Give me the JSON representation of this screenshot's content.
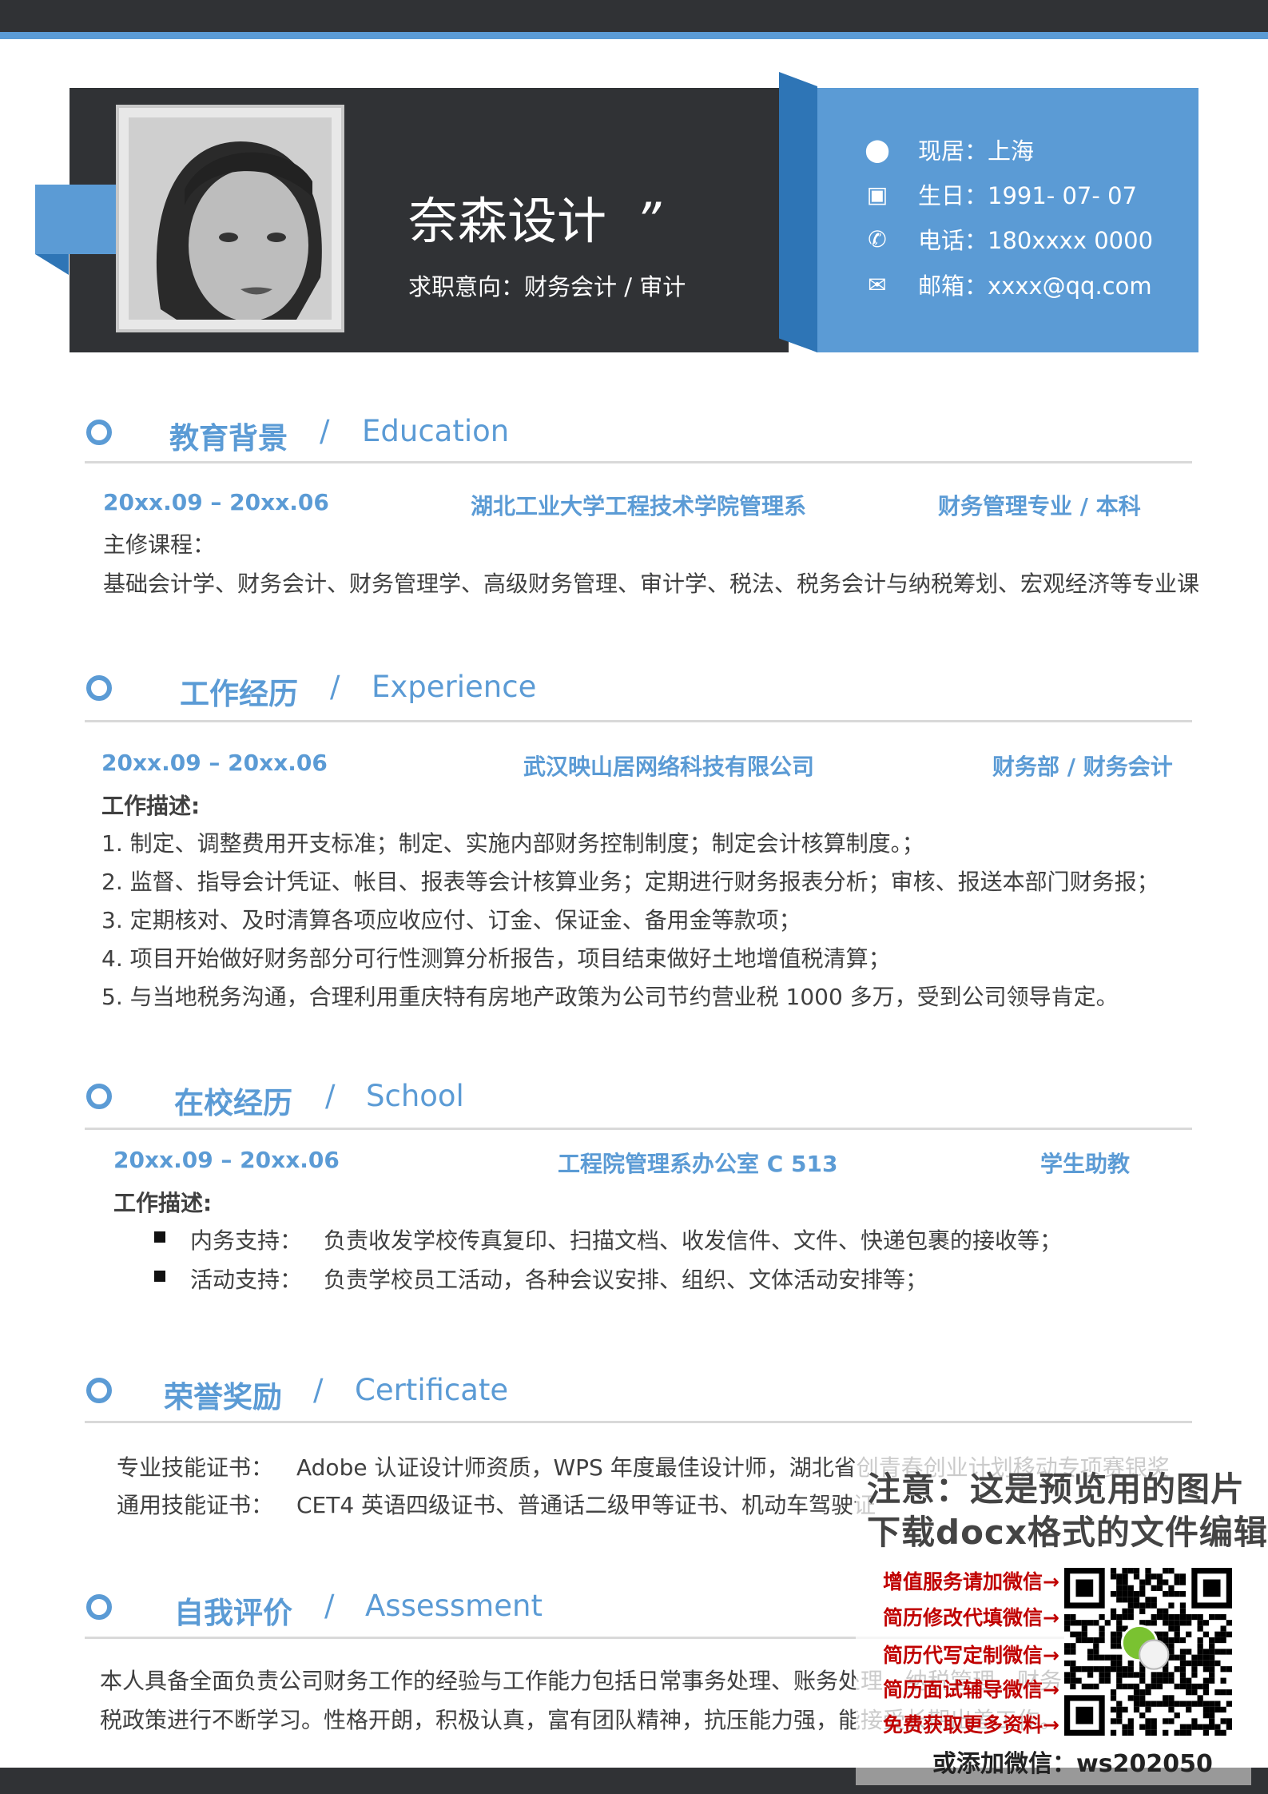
{
  "header": {
    "name": "奈森设计",
    "quote_mark": "”",
    "intent": "求职意向：财务会计 / 审计",
    "contacts": [
      {
        "icon": "location-pin-icon",
        "label": "现居：上海"
      },
      {
        "icon": "calendar-icon",
        "label": "生日：1991- 07- 07"
      },
      {
        "icon": "phone-icon",
        "label": "电话：180xxxx 0000"
      },
      {
        "icon": "mail-icon",
        "label": "邮箱：xxxx@qq.com"
      }
    ]
  },
  "sections": {
    "education": {
      "cn": "教育背景",
      "slash": "/",
      "en": "Education",
      "date": "20xx.09 – 20xx.06",
      "school": "湖北工业大学工程技术学院管理系",
      "major": "财务管理专业 / 本科",
      "courses_label": "主修课程：",
      "courses": "基础会计学、财务会计、财务管理学、高级财务管理、审计学、税法、税务会计与纳税筹划、宏观经济等专业课"
    },
    "experience": {
      "cn": "工作经历",
      "slash": "/",
      "en": "Experience",
      "date": "20xx.09 – 20xx.06",
      "company": "武汉映山居网络科技有限公司",
      "role": "财务部 / 财务会计",
      "desc_label": "工作描述:",
      "items": [
        "1. 制定、调整费用开支标准；制定、实施内部财务控制制度；制定会计核算制度。；",
        "2. 监督、指导会计凭证、帐目、报表等会计核算业务；定期进行财务报表分析；审核、报送本部门财务报；",
        "3. 定期核对、及时清算各项应收应付、订金、保证金、备用金等款项；",
        "4. 项目开始做好财务部分可行性测算分析报告，项目结束做好土地增值税清算；",
        "5. 与当地税务沟通，合理利用重庆特有房地产政策为公司节约营业税 1000 多万，受到公司领导肯定。"
      ]
    },
    "school": {
      "cn": "在校经历",
      "slash": "/",
      "en": "School",
      "date": "20xx.09 – 20xx.06",
      "org": "工程院管理系办公室 C 513",
      "role": "学生助教",
      "desc_label": "工作描述:",
      "items": [
        {
          "label": "内务支持：",
          "text": "负责收发学校传真复印、扫描文档、收发信件、文件、快递包裹的接收等；"
        },
        {
          "label": "活动支持：",
          "text": "负责学校员工活动，各种会议安排、组织、文体活动安排等；"
        }
      ]
    },
    "certificate": {
      "cn": "荣誉奖励",
      "slash": "/",
      "en": "Certificate",
      "rows": [
        {
          "label": "专业技能证书：",
          "text": "Adobe 认证设计师资质，WPS 年度最佳设计师，湖北省创青春创业计划移动专项赛银奖"
        },
        {
          "label": "通用技能证书：",
          "text": "CET4  英语四级证书、普通话二级甲等证书、机动车驾驶证"
        }
      ]
    },
    "assessment": {
      "cn": "自我评价",
      "slash": "/",
      "en": "Assessment",
      "lines": [
        "本人具备全面负责公司财务工作的经验与工作能力包括日常事务处理、账务处理、纳税管理、财务",
        "税政策进行不断学习。性格开朗，积极认真，富有团队精神，抗压能力强，能接受长期出差工作。"
      ]
    }
  },
  "overlay": {
    "notice1": "注意：这是预览用的图片",
    "notice2": "下载docx格式的文件编辑",
    "services": [
      "增值服务请加微信→",
      "简历修改代填微信→",
      "简历代写定制微信→",
      "简历面试辅导微信→",
      "免费获取更多资料→"
    ],
    "wechat": "或添加微信：ws202050"
  },
  "colors": {
    "accent": "#5b9bd5",
    "dark": "#303235",
    "accent_dark": "#2e75b6",
    "promo_red": "#c00000"
  }
}
